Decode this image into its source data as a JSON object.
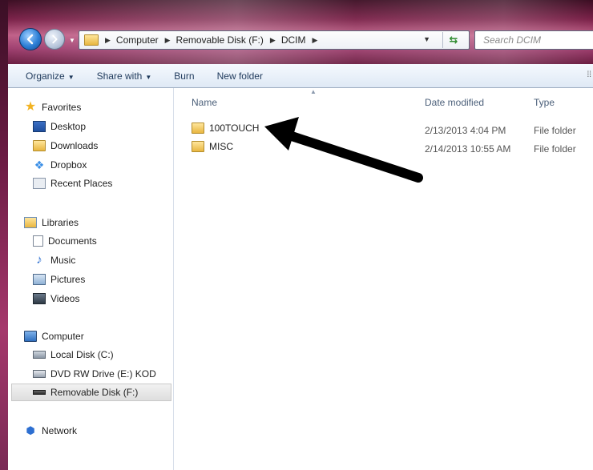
{
  "address": {
    "crumbs": [
      "Computer",
      "Removable Disk (F:)",
      "DCIM"
    ],
    "search_placeholder": "Search DCIM"
  },
  "toolbar": {
    "organize": "Organize",
    "share_with": "Share with",
    "burn": "Burn",
    "new_folder": "New folder"
  },
  "sidebar": {
    "favorites": {
      "label": "Favorites",
      "items": [
        "Desktop",
        "Downloads",
        "Dropbox",
        "Recent Places"
      ]
    },
    "libraries": {
      "label": "Libraries",
      "items": [
        "Documents",
        "Music",
        "Pictures",
        "Videos"
      ]
    },
    "computer": {
      "label": "Computer",
      "items": [
        "Local Disk (C:)",
        "DVD RW Drive (E:) KOD",
        "Removable Disk (F:)"
      ],
      "selected": "Removable Disk (F:)"
    },
    "network": {
      "label": "Network"
    }
  },
  "columns": {
    "name": "Name",
    "date_modified": "Date modified",
    "type": "Type"
  },
  "files": [
    {
      "name": "100TOUCH",
      "date": "2/13/2013 4:04 PM",
      "type": "File folder"
    },
    {
      "name": "MISC",
      "date": "2/14/2013 10:55 AM",
      "type": "File folder"
    }
  ],
  "colors": {
    "titlebar": "#7a2148",
    "selection_highlight": "#dedede",
    "arrow": "#000000"
  }
}
